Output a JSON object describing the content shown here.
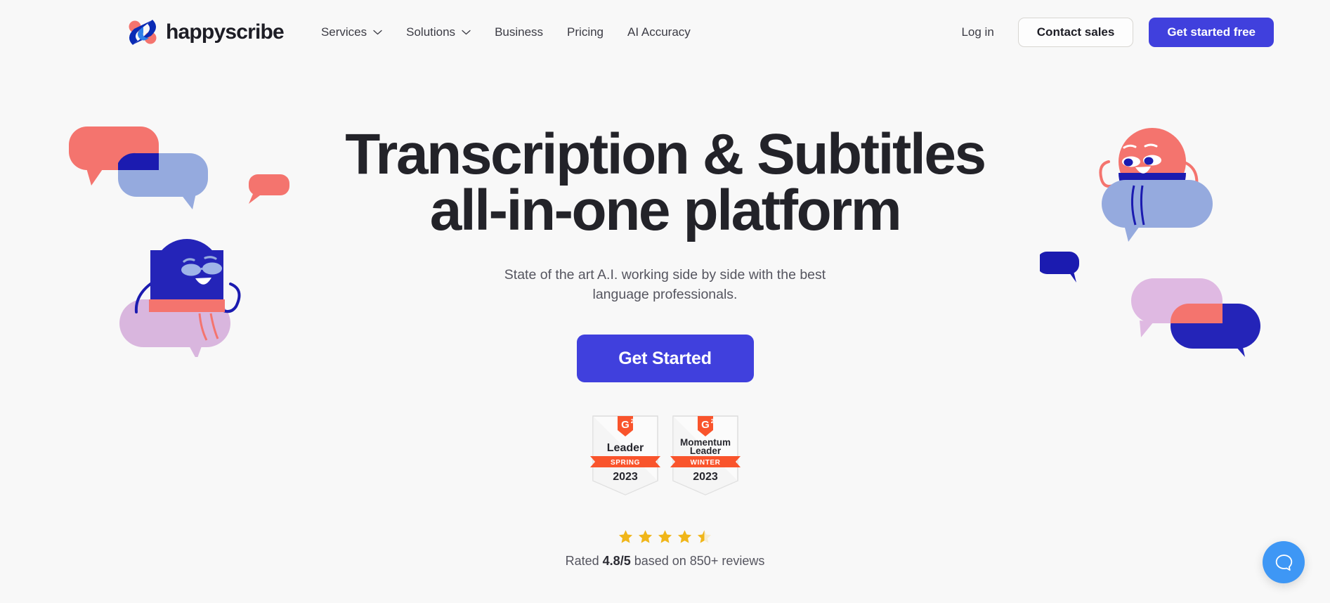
{
  "brand": {
    "name": "happyscribe",
    "logo_icon": "happyscribe-s-logo",
    "colors": {
      "navy": "#1b1bb0",
      "blue": "#2f7fe8",
      "coral": "#f4746e"
    }
  },
  "header": {
    "nav_items": [
      {
        "label": "Services",
        "has_dropdown": true,
        "icon": "chevron-down-icon"
      },
      {
        "label": "Solutions",
        "has_dropdown": true,
        "icon": "chevron-down-icon"
      },
      {
        "label": "Business",
        "has_dropdown": false,
        "icon": ""
      },
      {
        "label": "Pricing",
        "has_dropdown": false,
        "icon": ""
      },
      {
        "label": "AI Accuracy",
        "has_dropdown": false,
        "icon": ""
      }
    ],
    "login_label": "Log in",
    "contact_sales_label": "Contact sales",
    "get_started_free_label": "Get started free"
  },
  "hero": {
    "title_line_1": "Transcription & Subtitles",
    "title_line_2": "all-in-one platform",
    "subtitle": "State of the art A.I. working side by side with the best language professionals.",
    "cta_label": "Get Started",
    "accent_color": "#4040dd",
    "background_color": "#f8f8f8"
  },
  "badges": [
    {
      "provider_icon": "g2-icon",
      "title_line_1": "Leader",
      "title_line_2": "",
      "season": "SPRING",
      "year": "2023",
      "ribbon_color": "#f9542c"
    },
    {
      "provider_icon": "g2-icon",
      "title_line_1": "Momentum",
      "title_line_2": "Leader",
      "season": "WINTER",
      "year": "2023",
      "ribbon_color": "#f9542c"
    }
  ],
  "rating": {
    "stars": [
      "full",
      "full",
      "full",
      "full",
      "half"
    ],
    "star_color": "#f0b619",
    "prefix": "Rated ",
    "score": "4.8/5",
    "suffix": " based on 850+ reviews"
  },
  "illustrations": {
    "left_alt": "speech-bubbles-with-blue-character",
    "right_alt": "speech-bubbles-with-coral-character"
  },
  "support_widget": {
    "icon": "chat-bubble-icon",
    "color": "#3e97f5"
  }
}
